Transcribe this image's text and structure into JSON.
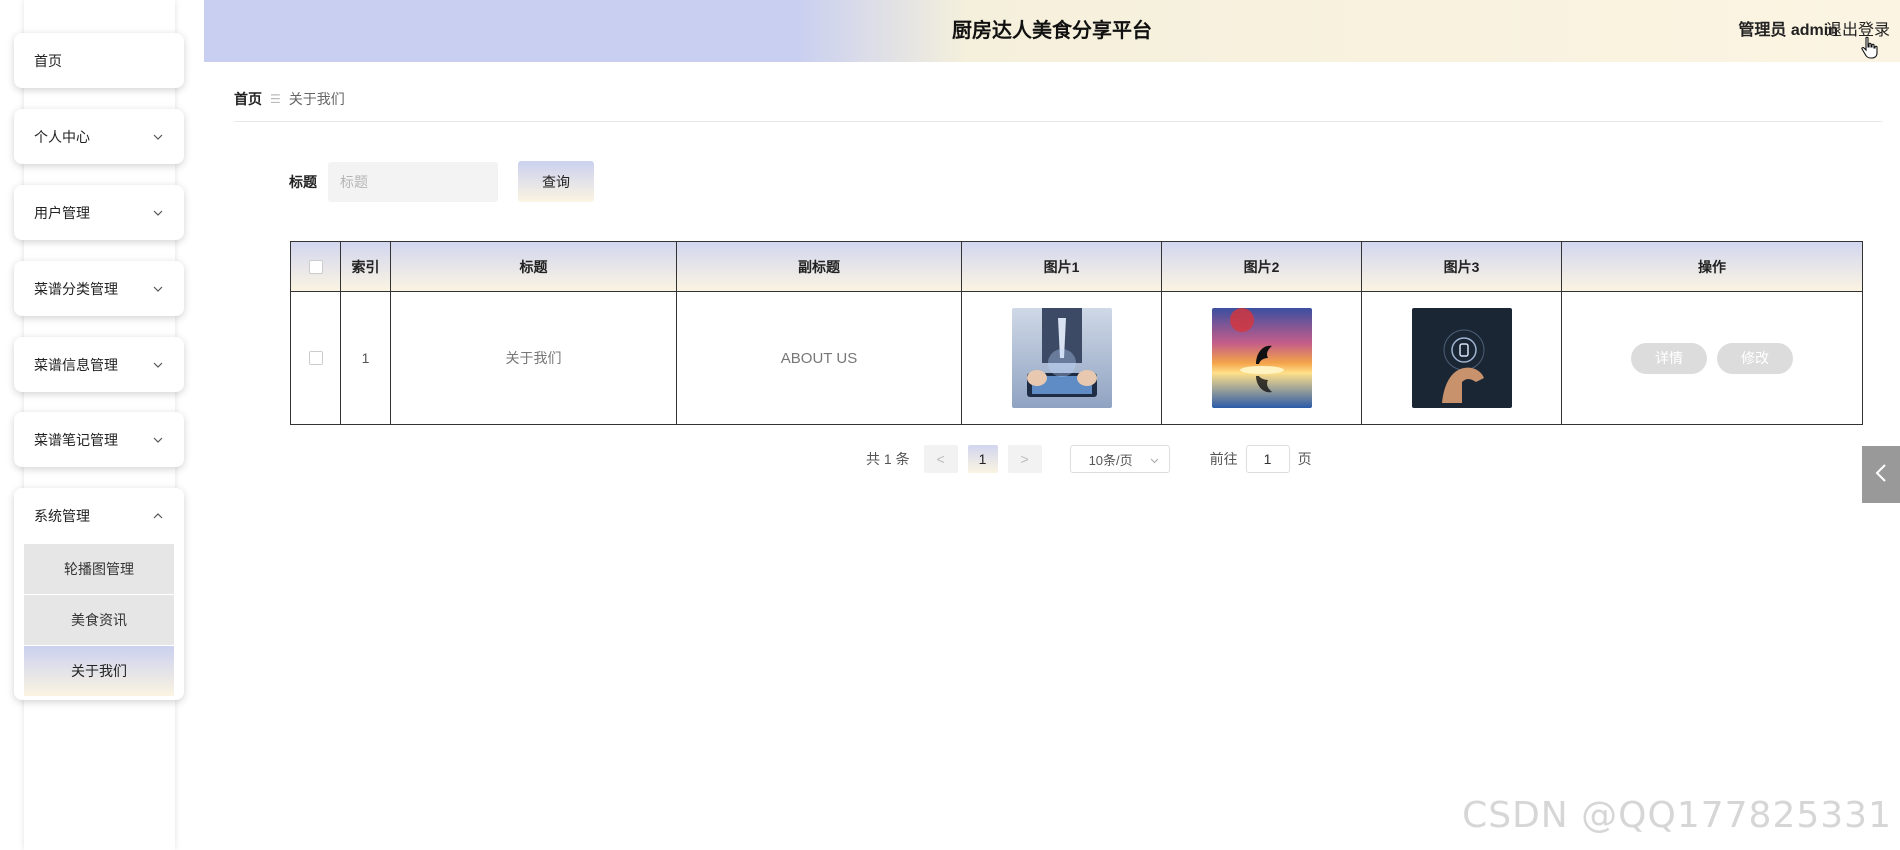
{
  "header": {
    "title": "厨房达人美食分享平台",
    "user_label": "管理员 admin",
    "logout_label": "退出登录"
  },
  "sidebar": {
    "items": [
      {
        "label": "首页"
      },
      {
        "label": "个人中心"
      },
      {
        "label": "用户管理"
      },
      {
        "label": "菜谱分类管理"
      },
      {
        "label": "菜谱信息管理"
      },
      {
        "label": "菜谱笔记管理"
      }
    ],
    "group": {
      "label": "系统管理",
      "children": [
        {
          "label": "轮播图管理"
        },
        {
          "label": "美食资讯"
        },
        {
          "label": "关于我们"
        }
      ]
    }
  },
  "breadcrumb": {
    "home": "首页",
    "separator": "☰",
    "current": "关于我们"
  },
  "search": {
    "label": "标题",
    "placeholder": "标题",
    "button": "查询"
  },
  "table": {
    "headers": [
      "索引",
      "标题",
      "副标题",
      "图片1",
      "图片2",
      "图片3",
      "操作"
    ],
    "rows": [
      {
        "index": "1",
        "title": "关于我们",
        "subtitle": "ABOUT US",
        "actions": {
          "detail": "详情",
          "edit": "修改"
        }
      }
    ]
  },
  "pagination": {
    "total": "共 1 条",
    "prev": "<",
    "current": "1",
    "next": ">",
    "page_size": "10条/页",
    "goto_label": "前往",
    "goto_value": "1",
    "page_suffix": "页"
  },
  "watermark": "CSDN @QQ177825331",
  "colors": {
    "accent_gradient_start": "#cbd1ef",
    "accent_gradient_end": "#fbf4e2",
    "action_button": "#dcdcdc"
  }
}
